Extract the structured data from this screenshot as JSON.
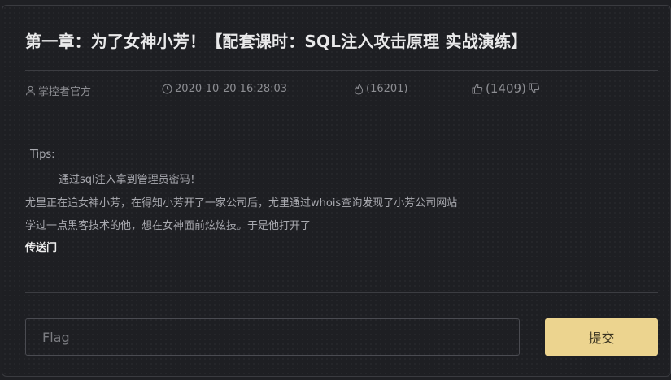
{
  "challenge": {
    "title": "第一章：为了女神小芳！【配套课时：SQL注入攻击原理 实战演练】",
    "author": "掌控者官方",
    "datetime": "2020-10-20 16:28:03",
    "views": "(16201)",
    "likes": "(1409)"
  },
  "description": {
    "tips_label": "Tips:",
    "tip_text": "通过sql注入拿到管理员密码！",
    "story_line1": "尤里正在追女神小芳，在得知小芳开了一家公司后，尤里通过whois查询发现了小芳公司网站",
    "story_line2": "学过一点黑客技术的他，想在女神面前炫炫技。于是他打开了",
    "portal_link": "传送门"
  },
  "form": {
    "flag_placeholder": "Flag",
    "submit_label": "提交"
  },
  "icons": {
    "author": "user-icon",
    "time": "clock-icon",
    "views": "fire-icon",
    "like": "thumbs-up-icon",
    "dislike": "thumbs-down-icon"
  },
  "colors": {
    "background": "#1e1f23",
    "submit_button": "#ecd48f"
  }
}
